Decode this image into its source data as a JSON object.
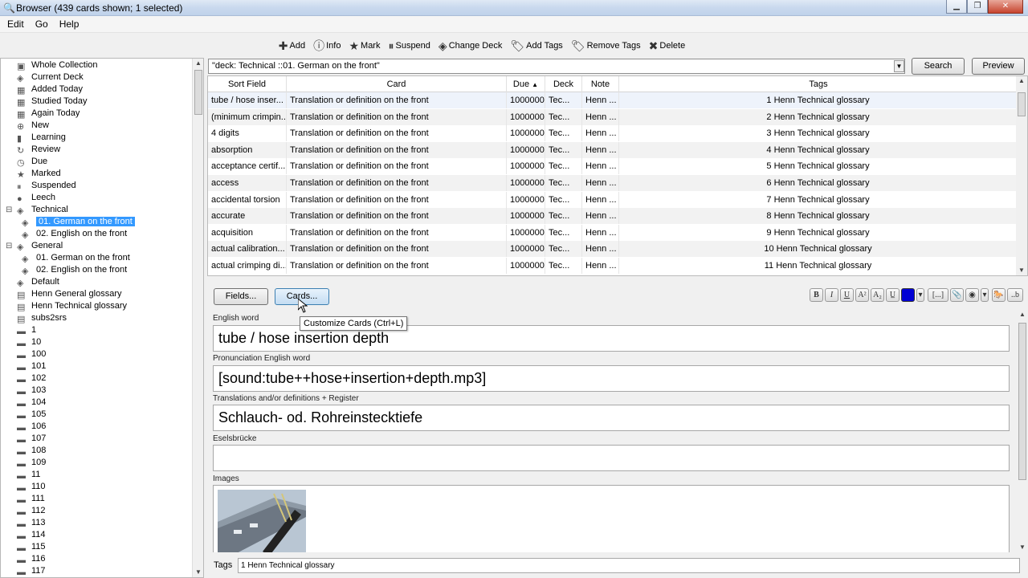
{
  "window": {
    "title": "Browser (439 cards shown; 1 selected)"
  },
  "menu": [
    "Edit",
    "Go",
    "Help"
  ],
  "toolbar": [
    {
      "label": "Add",
      "icon": "add-icon"
    },
    {
      "label": "Info",
      "icon": "info-icon"
    },
    {
      "label": "Mark",
      "icon": "star-icon"
    },
    {
      "label": "Suspend",
      "icon": "suspend-icon"
    },
    {
      "label": "Change Deck",
      "icon": "deck-icon"
    },
    {
      "label": "Add Tags",
      "icon": "tag-add-icon"
    },
    {
      "label": "Remove Tags",
      "icon": "tag-remove-icon"
    },
    {
      "label": "Delete",
      "icon": "delete-icon"
    }
  ],
  "sidebar": {
    "items": [
      {
        "label": "Whole Collection",
        "icon": "collection-icon",
        "indent": 0
      },
      {
        "label": "Current Deck",
        "icon": "deck-icon",
        "indent": 0
      },
      {
        "label": "Added Today",
        "icon": "calendar-icon",
        "indent": 0
      },
      {
        "label": "Studied Today",
        "icon": "calendar-icon",
        "indent": 0
      },
      {
        "label": "Again Today",
        "icon": "calendar-icon",
        "indent": 0
      },
      {
        "label": "New",
        "icon": "plus-circle-icon",
        "indent": 0
      },
      {
        "label": "Learning",
        "icon": "book-icon",
        "indent": 0
      },
      {
        "label": "Review",
        "icon": "refresh-icon",
        "indent": 0
      },
      {
        "label": "Due",
        "icon": "clock-icon",
        "indent": 0
      },
      {
        "label": "Marked",
        "icon": "star-icon",
        "indent": 0
      },
      {
        "label": "Suspended",
        "icon": "pause-icon",
        "indent": 0
      },
      {
        "label": "Leech",
        "icon": "leech-icon",
        "indent": 0
      },
      {
        "label": "Technical",
        "icon": "deck-icon",
        "indent": 0,
        "toggle": "⊟"
      },
      {
        "label": "01. German on the front",
        "icon": "deck-icon",
        "indent": 1,
        "selected": true
      },
      {
        "label": "02. English on the front",
        "icon": "deck-icon",
        "indent": 1
      },
      {
        "label": "General",
        "icon": "deck-icon",
        "indent": 0,
        "toggle": "⊟"
      },
      {
        "label": "01. German on the front",
        "icon": "deck-icon",
        "indent": 1
      },
      {
        "label": "02. English on the front",
        "icon": "deck-icon",
        "indent": 1
      },
      {
        "label": "Default",
        "icon": "deck-icon",
        "indent": 0
      },
      {
        "label": "Henn General glossary",
        "icon": "notetype-icon",
        "indent": 0
      },
      {
        "label": "Henn Technical glossary",
        "icon": "notetype-icon",
        "indent": 0
      },
      {
        "label": "subs2srs",
        "icon": "notetype-icon",
        "indent": 0
      },
      {
        "label": "1",
        "icon": "tag-icon",
        "indent": 0
      },
      {
        "label": "10",
        "icon": "tag-icon",
        "indent": 0
      },
      {
        "label": "100",
        "icon": "tag-icon",
        "indent": 0
      },
      {
        "label": "101",
        "icon": "tag-icon",
        "indent": 0
      },
      {
        "label": "102",
        "icon": "tag-icon",
        "indent": 0
      },
      {
        "label": "103",
        "icon": "tag-icon",
        "indent": 0
      },
      {
        "label": "104",
        "icon": "tag-icon",
        "indent": 0
      },
      {
        "label": "105",
        "icon": "tag-icon",
        "indent": 0
      },
      {
        "label": "106",
        "icon": "tag-icon",
        "indent": 0
      },
      {
        "label": "107",
        "icon": "tag-icon",
        "indent": 0
      },
      {
        "label": "108",
        "icon": "tag-icon",
        "indent": 0
      },
      {
        "label": "109",
        "icon": "tag-icon",
        "indent": 0
      },
      {
        "label": "11",
        "icon": "tag-icon",
        "indent": 0
      },
      {
        "label": "110",
        "icon": "tag-icon",
        "indent": 0
      },
      {
        "label": "111",
        "icon": "tag-icon",
        "indent": 0
      },
      {
        "label": "112",
        "icon": "tag-icon",
        "indent": 0
      },
      {
        "label": "113",
        "icon": "tag-icon",
        "indent": 0
      },
      {
        "label": "114",
        "icon": "tag-icon",
        "indent": 0
      },
      {
        "label": "115",
        "icon": "tag-icon",
        "indent": 0
      },
      {
        "label": "116",
        "icon": "tag-icon",
        "indent": 0
      },
      {
        "label": "117",
        "icon": "tag-icon",
        "indent": 0
      }
    ]
  },
  "search": {
    "query": "\"deck:    Technical ::01. German on the front\"",
    "search_label": "Search",
    "preview_label": "Preview"
  },
  "table": {
    "columns": [
      "Sort Field",
      "Card",
      "Due",
      "Deck",
      "Note",
      "Tags"
    ],
    "sort_indicator": "▲",
    "rows": [
      {
        "sort": "tube / hose inser...",
        "card": "Translation or definition on the front",
        "due": "1000000",
        "deck": "Tec...",
        "note": "Henn ...",
        "tags": "1 Henn Technical glossary"
      },
      {
        "sort": "(minimum crimpin...",
        "card": "Translation or definition on the front",
        "due": "1000000",
        "deck": "Tec...",
        "note": "Henn ...",
        "tags": "2 Henn Technical glossary"
      },
      {
        "sort": "4 digits",
        "card": "Translation or definition on the front",
        "due": "1000000",
        "deck": "Tec...",
        "note": "Henn ...",
        "tags": "3 Henn Technical glossary"
      },
      {
        "sort": "absorption",
        "card": "Translation or definition on the front",
        "due": "1000000",
        "deck": "Tec...",
        "note": "Henn ...",
        "tags": "4 Henn Technical glossary"
      },
      {
        "sort": "acceptance certif...",
        "card": "Translation or definition on the front",
        "due": "1000000",
        "deck": "Tec...",
        "note": "Henn ...",
        "tags": "5 Henn Technical glossary"
      },
      {
        "sort": "access",
        "card": "Translation or definition on the front",
        "due": "1000000",
        "deck": "Tec...",
        "note": "Henn ...",
        "tags": "6 Henn Technical glossary"
      },
      {
        "sort": "accidental torsion",
        "card": "Translation or definition on the front",
        "due": "1000000",
        "deck": "Tec...",
        "note": "Henn ...",
        "tags": "7 Henn Technical glossary"
      },
      {
        "sort": "accurate",
        "card": "Translation or definition on the front",
        "due": "1000000",
        "deck": "Tec...",
        "note": "Henn ...",
        "tags": "8 Henn Technical glossary"
      },
      {
        "sort": "acquisition",
        "card": "Translation or definition on the front",
        "due": "1000000",
        "deck": "Tec...",
        "note": "Henn ...",
        "tags": "9 Henn Technical glossary"
      },
      {
        "sort": "actual calibration...",
        "card": "Translation or definition on the front",
        "due": "1000000",
        "deck": "Tec...",
        "note": "Henn ...",
        "tags": "10 Henn Technical glossary"
      },
      {
        "sort": "actual crimping di...",
        "card": "Translation or definition on the front",
        "due": "1000000",
        "deck": "Tec...",
        "note": "Henn ...",
        "tags": "11 Henn Technical glossary"
      }
    ]
  },
  "editor": {
    "fields_button": "Fields...",
    "cards_button": "Cards...",
    "tooltip": "Customize Cards (Ctrl+L)",
    "format_buttons": [
      "B",
      "I",
      "U",
      "A²",
      "A₂",
      "U̲",
      "",
      "▾",
      "[...]",
      "📎",
      "◉",
      "▾",
      "🐎",
      "..b"
    ],
    "color": "#0000d4",
    "fields": [
      {
        "label": "English word",
        "value": "tube / hose insertion depth"
      },
      {
        "label": "Pronunciation English word",
        "value": "[sound:tube++hose+insertion+depth.mp3]"
      },
      {
        "label": "Translations and/or definitions + Register",
        "value": "Schlauch- od. Rohreinstecktiefe"
      },
      {
        "label": "Eselsbrücke",
        "value": ""
      },
      {
        "label": "Images",
        "value": ""
      }
    ],
    "tags_label": "Tags",
    "tags_value": "1 Henn Technical glossary"
  }
}
